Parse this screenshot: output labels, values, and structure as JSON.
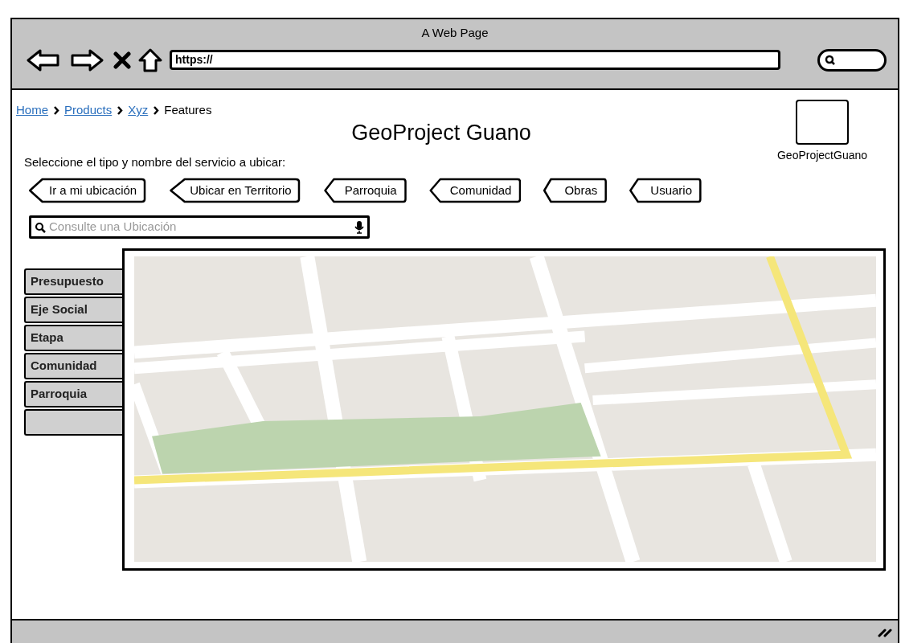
{
  "window": {
    "title": "A Web Page",
    "url": "https://"
  },
  "breadcrumb": [
    {
      "label": "Home",
      "link": true
    },
    {
      "label": "Products",
      "link": true
    },
    {
      "label": "Xyz",
      "link": true
    },
    {
      "label": "Features",
      "link": false
    }
  ],
  "heading": "GeoProject Guano",
  "logo": {
    "caption": "GeoProjectGuano"
  },
  "prompt": "Seleccione el tipo y nombre del servicio a ubicar:",
  "buttons": [
    "Ir a mi ubicación",
    "Ubicar en Territorio",
    "Parroquia",
    "Comunidad",
    "Obras",
    "Usuario"
  ],
  "search": {
    "placeholder": "Consulte una Ubicación"
  },
  "side_tabs": [
    "Presupuesto",
    "Eje Social",
    "Etapa",
    "Comunidad",
    "Parroquia"
  ],
  "map": {
    "kind": "picture"
  }
}
